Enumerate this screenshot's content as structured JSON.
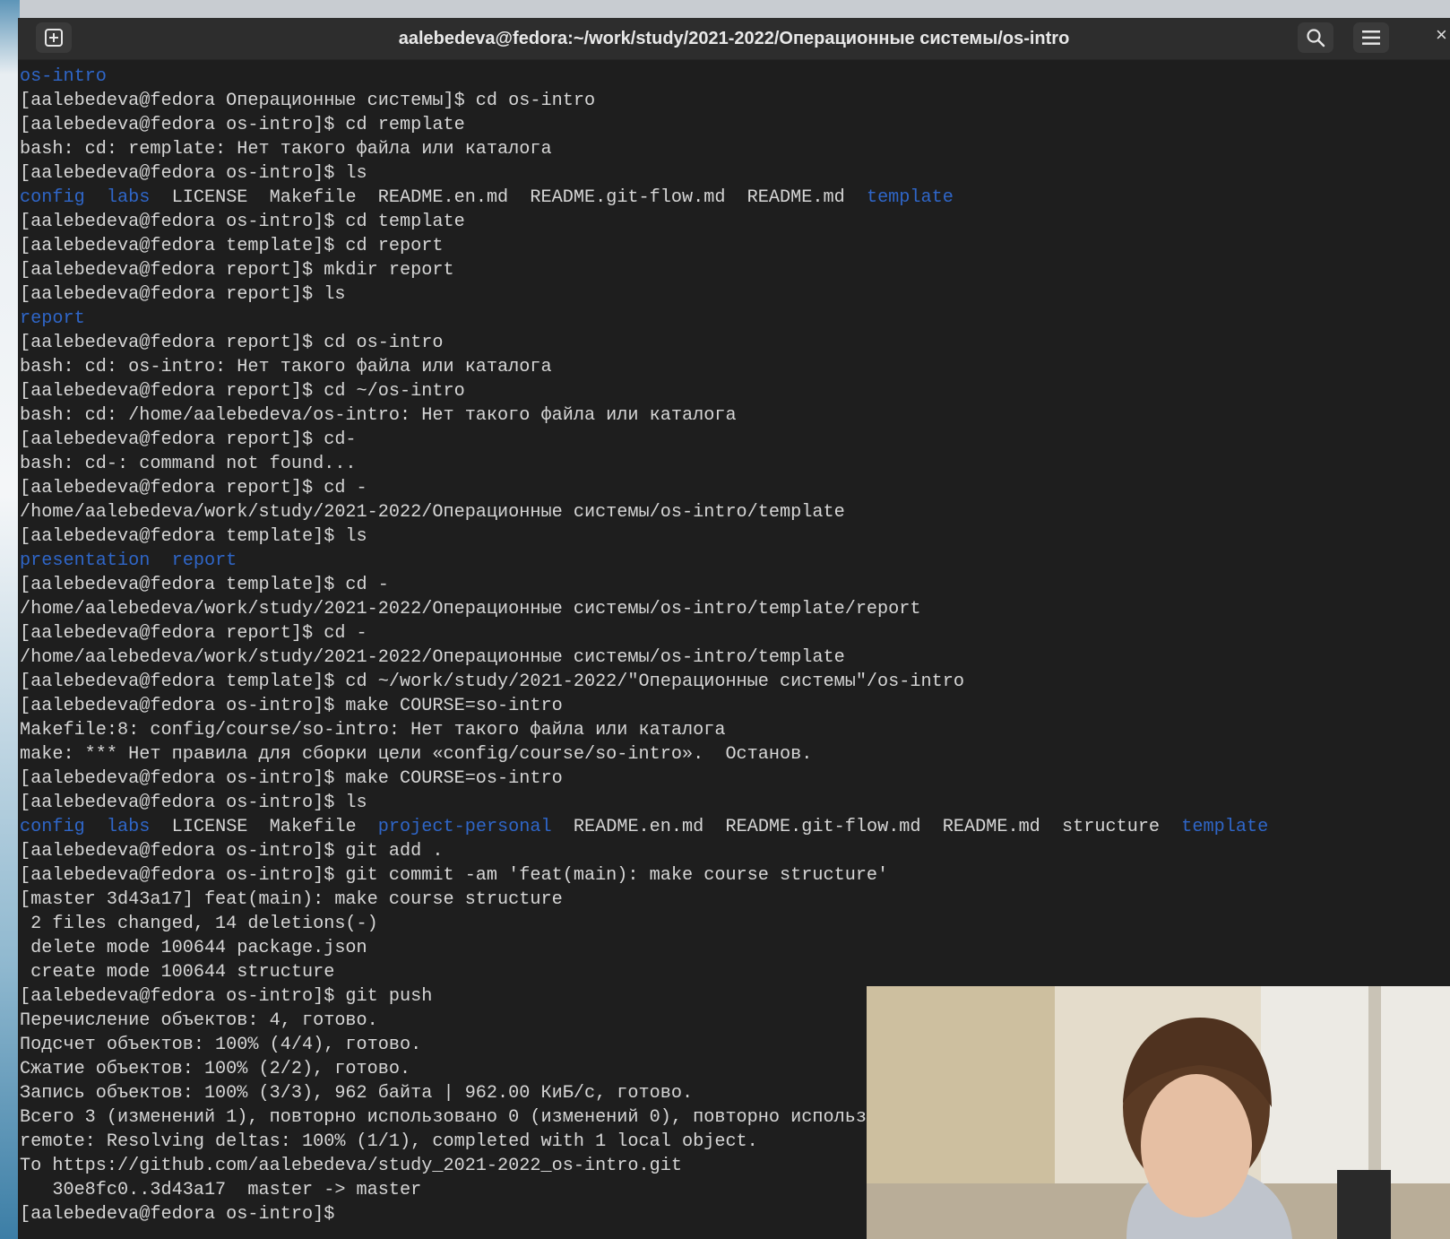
{
  "window": {
    "title": "aalebedeva@fedora:~/work/study/2021-2022/Операционные системы/os-intro"
  },
  "terminal": {
    "lines": [
      [
        {
          "t": "os-intro",
          "c": "dir"
        }
      ],
      [
        {
          "t": "[aalebedeva@fedora Операционные системы]$ cd os-intro"
        }
      ],
      [
        {
          "t": "[aalebedeva@fedora os-intro]$ cd remplate"
        }
      ],
      [
        {
          "t": "bash: cd: remplate: Нет такого файла или каталога"
        }
      ],
      [
        {
          "t": "[aalebedeva@fedora os-intro]$ ls"
        }
      ],
      [
        {
          "t": "config",
          "c": "dir"
        },
        {
          "t": "  "
        },
        {
          "t": "labs",
          "c": "dir"
        },
        {
          "t": "  LICENSE  Makefile  README.en.md  README.git-flow.md  README.md  "
        },
        {
          "t": "template",
          "c": "dir"
        }
      ],
      [
        {
          "t": "[aalebedeva@fedora os-intro]$ cd template"
        }
      ],
      [
        {
          "t": "[aalebedeva@fedora template]$ cd report"
        }
      ],
      [
        {
          "t": "[aalebedeva@fedora report]$ mkdir report"
        }
      ],
      [
        {
          "t": "[aalebedeva@fedora report]$ ls"
        }
      ],
      [
        {
          "t": "report",
          "c": "dir"
        }
      ],
      [
        {
          "t": "[aalebedeva@fedora report]$ cd os-intro"
        }
      ],
      [
        {
          "t": "bash: cd: os-intro: Нет такого файла или каталога"
        }
      ],
      [
        {
          "t": "[aalebedeva@fedora report]$ cd ~/os-intro"
        }
      ],
      [
        {
          "t": "bash: cd: /home/aalebedeva/os-intro: Нет такого файла или каталога"
        }
      ],
      [
        {
          "t": "[aalebedeva@fedora report]$ cd-"
        }
      ],
      [
        {
          "t": "bash: cd-: command not found..."
        }
      ],
      [
        {
          "t": "[aalebedeva@fedora report]$ cd -"
        }
      ],
      [
        {
          "t": "/home/aalebedeva/work/study/2021-2022/Операционные системы/os-intro/template"
        }
      ],
      [
        {
          "t": "[aalebedeva@fedora template]$ ls"
        }
      ],
      [
        {
          "t": "presentation",
          "c": "dir"
        },
        {
          "t": "  "
        },
        {
          "t": "report",
          "c": "dir"
        }
      ],
      [
        {
          "t": "[aalebedeva@fedora template]$ cd -"
        }
      ],
      [
        {
          "t": "/home/aalebedeva/work/study/2021-2022/Операционные системы/os-intro/template/report"
        }
      ],
      [
        {
          "t": "[aalebedeva@fedora report]$ cd -"
        }
      ],
      [
        {
          "t": "/home/aalebedeva/work/study/2021-2022/Операционные системы/os-intro/template"
        }
      ],
      [
        {
          "t": "[aalebedeva@fedora template]$ cd ~/work/study/2021-2022/\"Операционные системы\"/os-intro"
        }
      ],
      [
        {
          "t": "[aalebedeva@fedora os-intro]$ make COURSE=so-intro"
        }
      ],
      [
        {
          "t": "Makefile:8: config/course/so-intro: Нет такого файла или каталога"
        }
      ],
      [
        {
          "t": "make: *** Нет правила для сборки цели «config/course/so-intro».  Останов."
        }
      ],
      [
        {
          "t": "[aalebedeva@fedora os-intro]$ make COURSE=os-intro"
        }
      ],
      [
        {
          "t": "[aalebedeva@fedora os-intro]$ ls"
        }
      ],
      [
        {
          "t": "config",
          "c": "dir"
        },
        {
          "t": "  "
        },
        {
          "t": "labs",
          "c": "dir"
        },
        {
          "t": "  LICENSE  Makefile  "
        },
        {
          "t": "project-personal",
          "c": "dir"
        },
        {
          "t": "  README.en.md  README.git-flow.md  README.md  structure  "
        },
        {
          "t": "template",
          "c": "dir"
        }
      ],
      [
        {
          "t": "[aalebedeva@fedora os-intro]$ git add ."
        }
      ],
      [
        {
          "t": "[aalebedeva@fedora os-intro]$ git commit -am 'feat(main): make course structure'"
        }
      ],
      [
        {
          "t": "[master 3d43a17] feat(main): make course structure"
        }
      ],
      [
        {
          "t": " 2 files changed, 14 deletions(-)"
        }
      ],
      [
        {
          "t": " delete mode 100644 package.json"
        }
      ],
      [
        {
          "t": " create mode 100644 structure"
        }
      ],
      [
        {
          "t": "[aalebedeva@fedora os-intro]$ git push"
        }
      ],
      [
        {
          "t": "Перечисление объектов: 4, готово."
        }
      ],
      [
        {
          "t": "Подсчет объектов: 100% (4/4), готово."
        }
      ],
      [
        {
          "t": "Сжатие объектов: 100% (2/2), готово."
        }
      ],
      [
        {
          "t": "Запись объектов: 100% (3/3), 962 байта | 962.00 КиБ/с, готово."
        }
      ],
      [
        {
          "t": "Всего 3 (изменений 1), повторно использовано 0 (изменений 0), повторно использо"
        }
      ],
      [
        {
          "t": "remote: Resolving deltas: 100% (1/1), completed with 1 local object."
        }
      ],
      [
        {
          "t": "To https://github.com/aalebedeva/study_2021-2022_os-intro.git"
        }
      ],
      [
        {
          "t": "   30e8fc0..3d43a17  master -> master"
        }
      ],
      [
        {
          "t": "[aalebedeva@fedora os-intro]$ "
        }
      ]
    ]
  },
  "icons": {
    "new_tab": "new-tab-icon",
    "search": "search-icon",
    "menu": "hamburger-menu-icon",
    "close": "close-icon"
  },
  "colors": {
    "terminal_bg": "#1e1e1e",
    "terminal_fg": "#d6d6d6",
    "directory": "#2f66c8",
    "titlebar_bg": "#2d2d2d"
  }
}
